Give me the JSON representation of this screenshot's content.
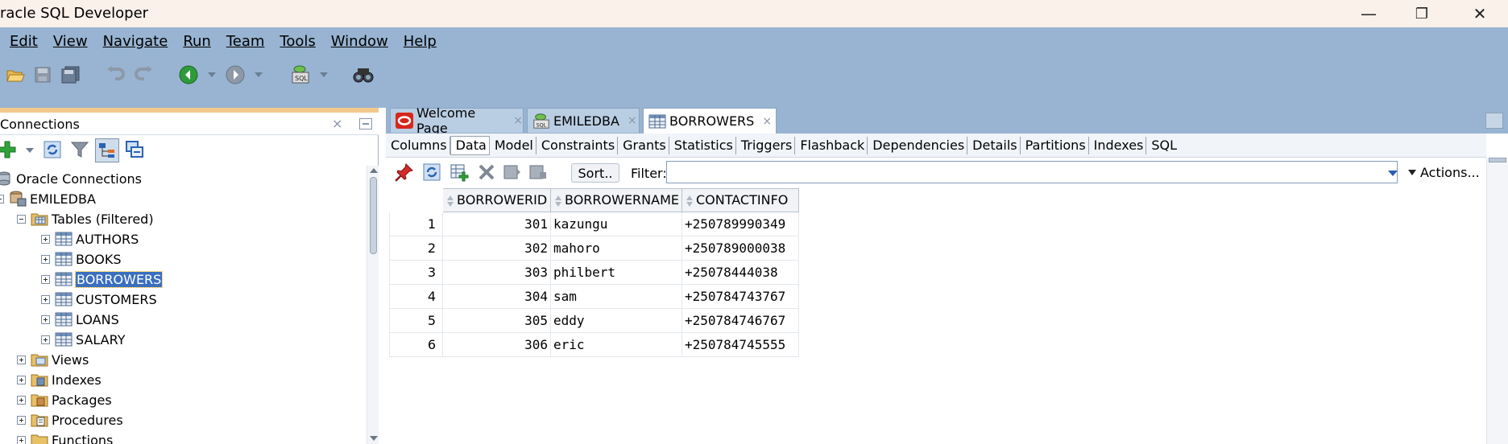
{
  "window": {
    "title": "racle SQL Developer",
    "controls": {
      "minimize": "—",
      "restore": "❐",
      "close": "✕"
    }
  },
  "menubar": {
    "items": [
      {
        "label": "Edit"
      },
      {
        "label": "View"
      },
      {
        "label": "Navigate"
      },
      {
        "label": "Run"
      },
      {
        "label": "Team"
      },
      {
        "label": "Tools"
      },
      {
        "label": "Window"
      },
      {
        "label": "Help"
      }
    ]
  },
  "toolbar": {
    "icons": [
      "open-folder-icon",
      "save-icon",
      "save-all-icon",
      "undo-icon",
      "redo-icon",
      "back-icon",
      "forward-icon",
      "sql-worksheet-icon",
      "find-icon"
    ]
  },
  "connections": {
    "title": "Connections",
    "close_glyph": "×",
    "tree": [
      {
        "label": "Oracle Connections",
        "icon": "connections-root-icon"
      },
      {
        "label": "EMILEDBA",
        "icon": "database-connection-icon"
      },
      {
        "label": "Tables (Filtered)",
        "icon": "tables-folder-icon"
      },
      {
        "label": "AUTHORS",
        "icon": "table-icon"
      },
      {
        "label": "BOOKS",
        "icon": "table-icon"
      },
      {
        "label": "BORROWERS",
        "icon": "table-icon",
        "selected": true
      },
      {
        "label": "CUSTOMERS",
        "icon": "table-icon"
      },
      {
        "label": "LOANS",
        "icon": "table-icon"
      },
      {
        "label": "SALARY",
        "icon": "table-icon"
      },
      {
        "label": "Views",
        "icon": "views-folder-icon"
      },
      {
        "label": "Indexes",
        "icon": "indexes-folder-icon"
      },
      {
        "label": "Packages",
        "icon": "packages-folder-icon"
      },
      {
        "label": "Procedures",
        "icon": "procedures-folder-icon"
      },
      {
        "label": "Functions",
        "icon": "functions-folder-icon"
      }
    ]
  },
  "editor": {
    "tabs": [
      {
        "label": "Welcome Page",
        "icon": "oracle-icon"
      },
      {
        "label": "EMILEDBA",
        "icon": "sql-connection-icon"
      },
      {
        "label": "BORROWERS",
        "icon": "table-icon",
        "active": true
      }
    ],
    "close_glyph": "×",
    "subtabs": [
      "Columns",
      "Data",
      "Model",
      "Constraints",
      "Grants",
      "Statistics",
      "Triggers",
      "Flashback",
      "Dependencies",
      "Details",
      "Partitions",
      "Indexes",
      "SQL"
    ],
    "active_subtab": "Data",
    "data_toolbar": {
      "sort_label": "Sort..",
      "filter_label": "Filter:",
      "filter_value": "",
      "actions_label": "Actions..."
    },
    "grid": {
      "columns": [
        "BORROWERID",
        "BORROWERNAME",
        "CONTACTINFO"
      ],
      "rows": [
        {
          "n": "1",
          "id": "301",
          "name": "kazungu",
          "contact": "+250789990349"
        },
        {
          "n": "2",
          "id": "302",
          "name": "mahoro",
          "contact": "+250789000038"
        },
        {
          "n": "3",
          "id": "303",
          "name": "philbert",
          "contact": "+25078444038"
        },
        {
          "n": "4",
          "id": "304",
          "name": "sam",
          "contact": "+250784743767"
        },
        {
          "n": "5",
          "id": "305",
          "name": "eddy",
          "contact": "+250784746767"
        },
        {
          "n": "6",
          "id": "306",
          "name": "eric",
          "contact": "+250784745555"
        }
      ]
    }
  }
}
